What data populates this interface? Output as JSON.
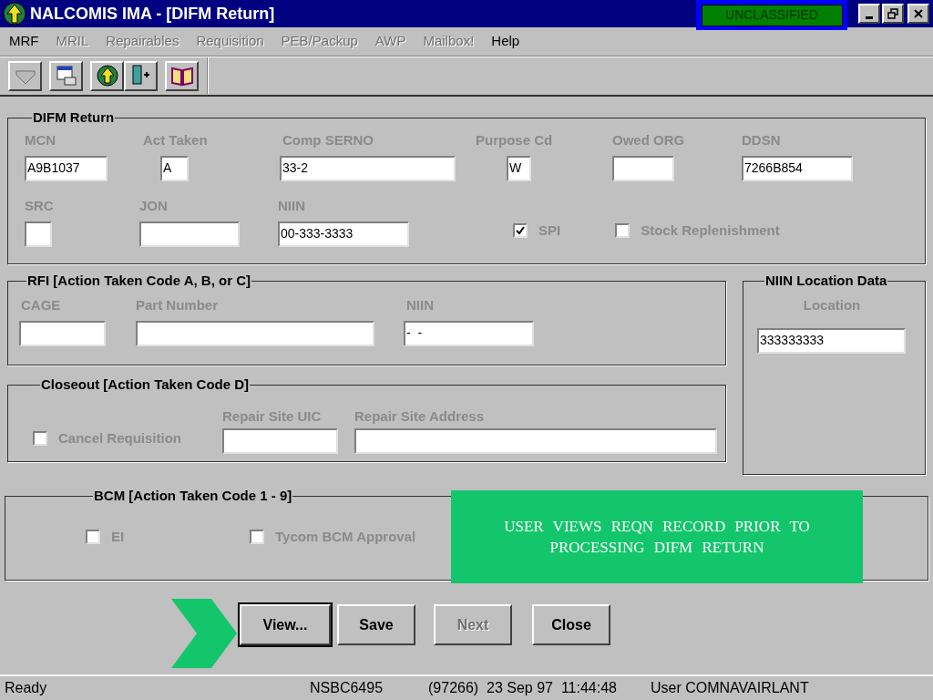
{
  "window": {
    "title": "NALCOMIS IMA - [DIFM Return]",
    "classification": "UNCLASSIFIED"
  },
  "menu": [
    {
      "label": "MRF",
      "disabled": false
    },
    {
      "label": "MRIL",
      "disabled": true
    },
    {
      "label": "Repairables",
      "disabled": true
    },
    {
      "label": "Requisition",
      "disabled": true
    },
    {
      "label": "PEB/Packup",
      "disabled": true
    },
    {
      "label": "AWP",
      "disabled": true
    },
    {
      "label": "Mailbox!",
      "disabled": true
    },
    {
      "label": "Help",
      "disabled": false
    }
  ],
  "difm_return": {
    "title": "DIFM Return",
    "fields": [
      {
        "label": "MCN",
        "value": "A9B1037"
      },
      {
        "label": "Act Taken",
        "value": "A"
      },
      {
        "label": "Comp SERNO",
        "value": "33-2"
      },
      {
        "label": "Purpose Cd",
        "value": "W"
      },
      {
        "label": "Owed ORG"
      },
      {
        "label": "DDSN",
        "value": "7266B854"
      },
      {
        "label": "SRC"
      },
      {
        "label": "JON"
      },
      {
        "label": "NIIN",
        "value": "00-333-3333"
      }
    ],
    "checkboxes": [
      {
        "label": "SPI",
        "checked": true
      },
      {
        "label": "Stock Replenishment",
        "checked": false
      }
    ]
  },
  "rfi": {
    "title": "RFI [Action Taken Code A, B, or C]",
    "fields": [
      {
        "label": "CAGE"
      },
      {
        "label": "Part Number"
      },
      {
        "label": "NIIN",
        "value": "-  -"
      }
    ]
  },
  "niin_location": {
    "title": "NIIN Location Data",
    "label": "Location",
    "value": "333333333"
  },
  "closeout": {
    "title": "Closeout [Action Taken Code D]",
    "checkbox": {
      "label": "Cancel Requisition",
      "checked": false
    },
    "fields": [
      {
        "label": "Repair Site UIC"
      },
      {
        "label": "Repair Site Address"
      }
    ]
  },
  "bcm": {
    "title": "BCM [Action Taken Code 1 - 9]",
    "checkboxes": [
      {
        "label": "EI",
        "checked": false
      },
      {
        "label": "Tycom BCM Approval",
        "checked": false
      }
    ]
  },
  "callout": {
    "text": "USER VIEWS REQN RECORD PRIOR TO PROCESSING DIFM RETURN"
  },
  "buttons": [
    {
      "label": "View...",
      "disabled": false,
      "focused": true
    },
    {
      "label": "Save",
      "disabled": false,
      "focused": false
    },
    {
      "label": "Next",
      "disabled": true,
      "focused": false
    },
    {
      "label": "Close",
      "disabled": false,
      "focused": false
    }
  ],
  "status_bar": [
    "Ready",
    "NSBC6495",
    "(97266)  23 Sep 97  11:44:48",
    "User COMNAVAIRLANT"
  ]
}
